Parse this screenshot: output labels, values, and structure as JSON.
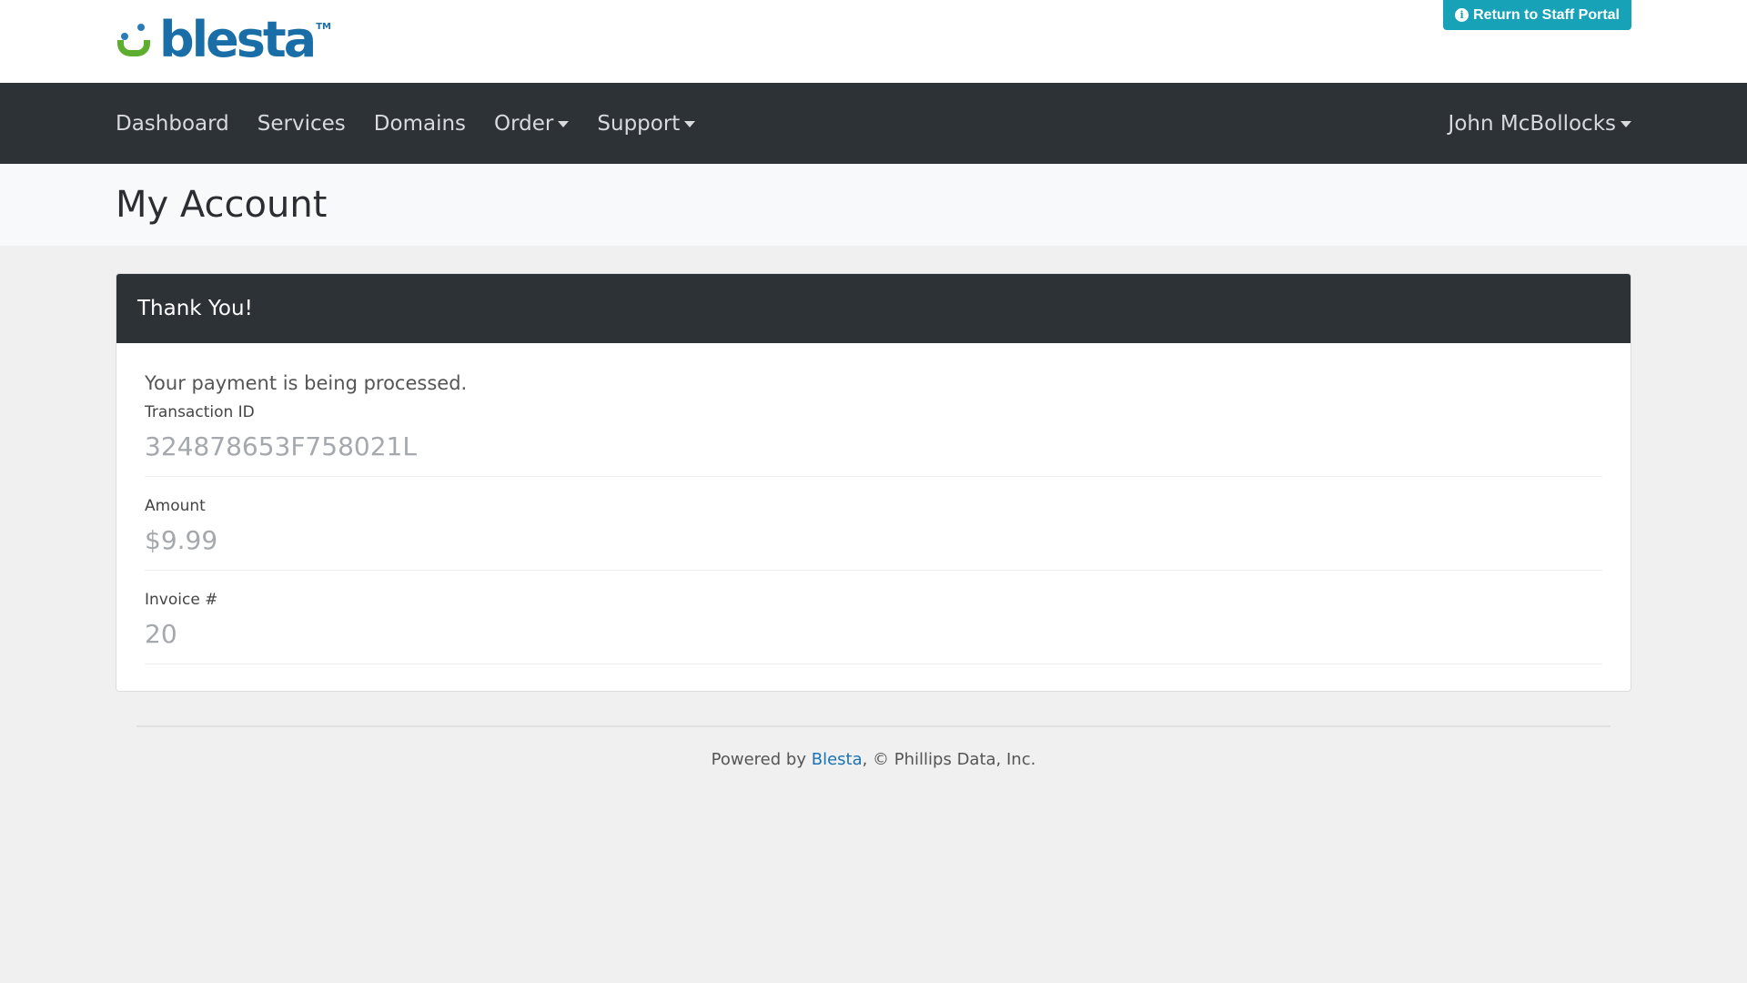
{
  "header": {
    "logo_text": "blesta",
    "logo_tm": "TM",
    "staff_portal_button": "Return to Staff Portal"
  },
  "nav": {
    "items": [
      {
        "label": "Dashboard",
        "dropdown": false
      },
      {
        "label": "Services",
        "dropdown": false
      },
      {
        "label": "Domains",
        "dropdown": false
      },
      {
        "label": "Order",
        "dropdown": true
      },
      {
        "label": "Support",
        "dropdown": true
      }
    ],
    "user_menu": "John McBollocks"
  },
  "page": {
    "title": "My Account"
  },
  "card": {
    "header": "Thank You!",
    "message": "Your payment is being processed.",
    "fields": [
      {
        "label": "Transaction ID",
        "value": "324878653F758021L"
      },
      {
        "label": "Amount",
        "value": "$9.99"
      },
      {
        "label": "Invoice #",
        "value": "20"
      }
    ]
  },
  "footer": {
    "prefix": "Powered by ",
    "link_text": "Blesta",
    "suffix": ", © Phillips Data, Inc."
  },
  "colors": {
    "navbar": "#2d3237",
    "accent_button": "#17a2b8",
    "link": "#1a73b5"
  }
}
